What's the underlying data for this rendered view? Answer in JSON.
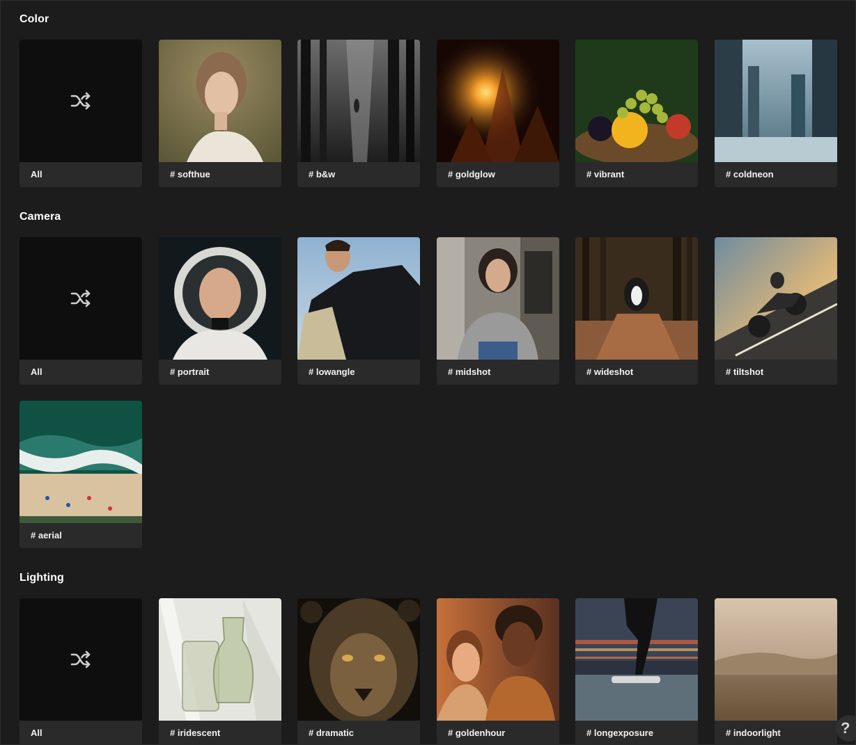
{
  "sections": [
    {
      "title": "Color",
      "cards": [
        {
          "label": "All",
          "icon": "shuffle-icon"
        },
        {
          "label": "# softhue"
        },
        {
          "label": "# b&w"
        },
        {
          "label": "# goldglow"
        },
        {
          "label": "# vibrant"
        },
        {
          "label": "# coldneon"
        }
      ]
    },
    {
      "title": "Camera",
      "cards": [
        {
          "label": "All",
          "icon": "shuffle-icon"
        },
        {
          "label": "# portrait"
        },
        {
          "label": "# lowangle"
        },
        {
          "label": "# midshot"
        },
        {
          "label": "# wideshot"
        },
        {
          "label": "# tiltshot"
        },
        {
          "label": "# aerial"
        }
      ]
    },
    {
      "title": "Lighting",
      "cards": [
        {
          "label": "All",
          "icon": "shuffle-icon"
        },
        {
          "label": "# iridescent"
        },
        {
          "label": "# dramatic"
        },
        {
          "label": "# goldenhour"
        },
        {
          "label": "# longexposure"
        },
        {
          "label": "# indoorlight"
        }
      ]
    }
  ],
  "help": {
    "label": "?",
    "icon": "help-icon"
  },
  "colors": {
    "background": "#1c1c1c",
    "card": "#2a2a2a",
    "shuffle_bg": "#0e0e0e"
  }
}
